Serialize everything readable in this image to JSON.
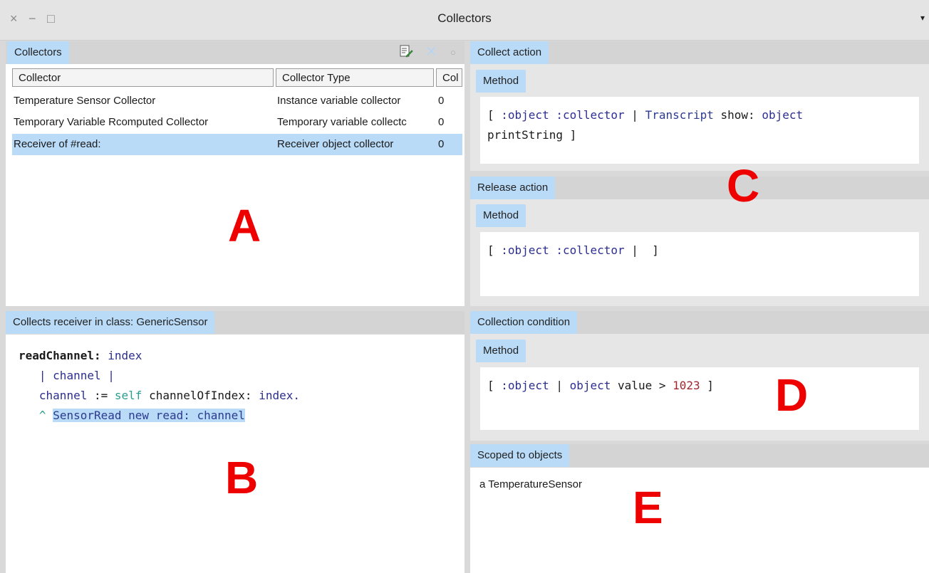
{
  "window": {
    "title": "Collectors",
    "close": "×",
    "minimize": "−",
    "maximize": "□",
    "menu": "▾"
  },
  "collectors_panel": {
    "tab": "Collectors",
    "columns": [
      "Collector",
      "Collector Type",
      "Col"
    ],
    "rows": [
      {
        "name": "Temperature Sensor Collector",
        "type": "Instance variable collector",
        "count": "0",
        "selected": false
      },
      {
        "name": "Temporary Variable Rcomputed Collector",
        "type": "Temporary variable collectc",
        "count": "0",
        "selected": false
      },
      {
        "name": "Receiver of #read:",
        "type": "Receiver object collector",
        "count": "0",
        "selected": true
      }
    ]
  },
  "source_panel": {
    "tab": "Collects receiver in class: GenericSensor",
    "selector": "readChannel:",
    "arg": "index",
    "temps": "| channel |",
    "line3_var": "channel",
    "line3_assign": ":=",
    "line3_self": "self",
    "line3_msg": "channelOfIndex:",
    "line3_arg": "index.",
    "line4_caret": "^",
    "line4_selected": "SensorRead new read: channel"
  },
  "collect_action": {
    "tab": "Collect action",
    "subtab": "Method",
    "l1_open": "[ ",
    "l1_params": ":object :collector",
    "l1_bar": " | ",
    "l1_class": "Transcript",
    "l1_msg": " show: ",
    "l1_obj": "object",
    "l2": "printString ]"
  },
  "release_action": {
    "tab": "Release action",
    "subtab": "Method",
    "l1_open": "[ ",
    "l1_params": ":object :collector",
    "l1_close": " |  ]"
  },
  "collection_condition": {
    "tab": "Collection condition",
    "subtab": "Method",
    "l1_open": "[ ",
    "l1_param": ":object",
    "l1_bar": " | ",
    "l1_obj": "object",
    "l1_msg": " value > ",
    "l1_num": "1023",
    "l1_close": " ]"
  },
  "scoped_objects": {
    "tab": "Scoped to objects",
    "items": [
      "a TemperatureSensor"
    ]
  },
  "annotations": {
    "a": "A",
    "b": "B",
    "c": "C",
    "d": "D",
    "e": "E"
  },
  "icons": [
    "edit-collector-icon",
    "remove-collector-icon",
    "toggle-collector-icon"
  ]
}
